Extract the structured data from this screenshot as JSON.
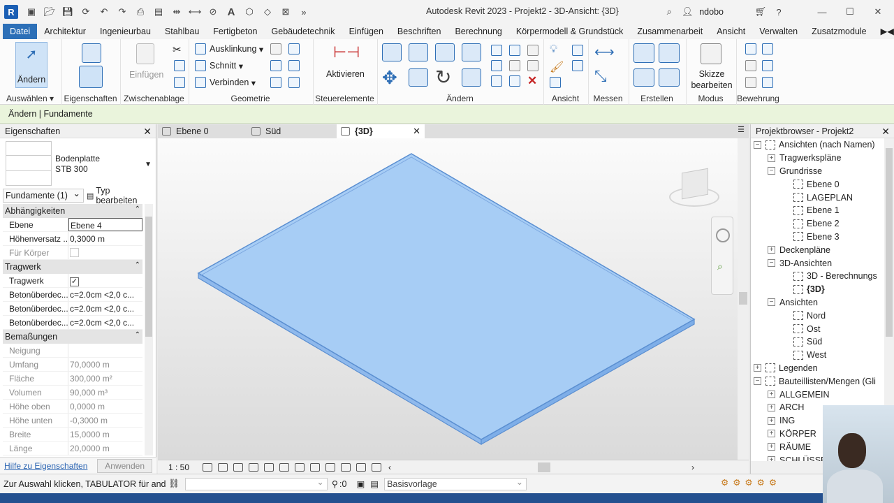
{
  "titlebar": {
    "app_icon_letter": "R",
    "title": "Autodesk Revit 2023 - Projekt2 - 3D-Ansicht: {3D}",
    "user": "ndobo"
  },
  "ribbon_tabs": [
    "Datei",
    "Architektur",
    "Ingenieurbau",
    "Stahlbau",
    "Fertigbeton",
    "Gebäudetechnik",
    "Einfügen",
    "Beschriften",
    "Berechnung",
    "Körpermodell & Grundstück",
    "Zusammenarbeit",
    "Ansicht",
    "Verwalten",
    "Zusatzmodule"
  ],
  "ribbon": {
    "modify_label": "Ändern",
    "paste_label": "Einfügen",
    "cope_label": "Ausklinkung",
    "cut_label": "Schnitt",
    "join_label": "Verbinden",
    "activate_label": "Aktivieren",
    "sketch_label": "Skizze bearbeiten",
    "groups": {
      "select": "Auswählen",
      "properties": "Eigenschaften",
      "clipboard": "Zwischenablage",
      "geometry": "Geometrie",
      "controls": "Steuerelemente",
      "modify": "Ändern",
      "view": "Ansicht",
      "measure": "Messen",
      "create": "Erstellen",
      "mode": "Modus",
      "reinforcement": "Bewehrung"
    }
  },
  "context": "Ändern | Fundamente",
  "properties": {
    "title": "Eigenschaften",
    "family": "Bodenplatte",
    "type": "STB 300",
    "selector": "Fundamente (1)",
    "edit_type": "Typ bearbeiten",
    "categories": [
      {
        "name": "Abhängigkeiten",
        "rows": [
          {
            "name": "Ebene",
            "value": "Ebene 4",
            "style": "boxed"
          },
          {
            "name": "Höhenversatz ...",
            "value": "0,3000 m",
            "style": "normal"
          },
          {
            "name": "Für Körper",
            "value": "",
            "style": "check-grey"
          }
        ]
      },
      {
        "name": "Tragwerk",
        "rows": [
          {
            "name": "Tragwerk",
            "value": "✓",
            "style": "check"
          },
          {
            "name": "Betonüberdec...",
            "value": "c=2.0cm <2,0 c...",
            "style": "normal"
          },
          {
            "name": "Betonüberdec...",
            "value": "c=2.0cm <2,0 c...",
            "style": "normal"
          },
          {
            "name": "Betonüberdec...",
            "value": "c=2.0cm <2,0 c...",
            "style": "normal"
          }
        ]
      },
      {
        "name": "Bemaßungen",
        "rows": [
          {
            "name": "Neigung",
            "value": "",
            "style": "dim"
          },
          {
            "name": "Umfang",
            "value": "70,0000 m",
            "style": "dim"
          },
          {
            "name": "Fläche",
            "value": "300,000 m²",
            "style": "dim"
          },
          {
            "name": "Volumen",
            "value": "90,000 m³",
            "style": "dim"
          },
          {
            "name": "Höhe oben",
            "value": "0,0000 m",
            "style": "dim"
          },
          {
            "name": "Höhe unten",
            "value": "-0,3000 m",
            "style": "dim"
          },
          {
            "name": "Breite",
            "value": "15,0000 m",
            "style": "dim"
          },
          {
            "name": "Länge",
            "value": "20,0000 m",
            "style": "dim"
          }
        ]
      }
    ],
    "help": "Hilfe zu Eigenschaften",
    "apply": "Anwenden"
  },
  "view_tabs": [
    {
      "label": "Ebene 0",
      "active": false
    },
    {
      "label": "Süd",
      "active": false
    },
    {
      "label": "{3D}",
      "active": true
    }
  ],
  "viewport": {
    "scale": "1 : 50",
    "slab_color": "#a7cdf5",
    "slab_edge_color": "#6d9edb"
  },
  "browser": {
    "title": "Projektbrowser - Projekt2",
    "items": [
      {
        "label": "Ansichten (nach Namen)",
        "level": 0,
        "exp": "−",
        "icon": true
      },
      {
        "label": "Tragwerkspläne",
        "level": 1,
        "exp": "+"
      },
      {
        "label": "Grundrisse",
        "level": 1,
        "exp": "−"
      },
      {
        "label": "Ebene 0",
        "level": 2,
        "icon": true
      },
      {
        "label": "LAGEPLAN",
        "level": 2,
        "icon": true
      },
      {
        "label": "Ebene 1",
        "level": 2,
        "icon": true
      },
      {
        "label": "Ebene 2",
        "level": 2,
        "icon": true
      },
      {
        "label": "Ebene 3",
        "level": 2,
        "icon": true
      },
      {
        "label": "Deckenpläne",
        "level": 1,
        "exp": "+"
      },
      {
        "label": "3D-Ansichten",
        "level": 1,
        "exp": "−"
      },
      {
        "label": "3D - Berechnungs",
        "level": 2,
        "icon": true
      },
      {
        "label": "{3D}",
        "level": 2,
        "icon": true,
        "bold": true
      },
      {
        "label": "Ansichten",
        "level": 1,
        "exp": "−"
      },
      {
        "label": "Nord",
        "level": 2,
        "icon": true
      },
      {
        "label": "Ost",
        "level": 2,
        "icon": true
      },
      {
        "label": "Süd",
        "level": 2,
        "icon": true
      },
      {
        "label": "West",
        "level": 2,
        "icon": true
      },
      {
        "label": "Legenden",
        "level": 0,
        "exp": "+",
        "icon": true
      },
      {
        "label": "Bauteillisten/Mengen (Gli",
        "level": 0,
        "exp": "−",
        "icon": true
      },
      {
        "label": "ALLGEMEIN",
        "level": 1,
        "exp": "+"
      },
      {
        "label": "ARCH",
        "level": 1,
        "exp": "+"
      },
      {
        "label": "ING",
        "level": 1,
        "exp": "+"
      },
      {
        "label": "KÖRPER",
        "level": 1,
        "exp": "+"
      },
      {
        "label": "RÄUME",
        "level": 1,
        "exp": "+"
      },
      {
        "label": "SCHLÜSSE",
        "level": 1,
        "exp": "+"
      }
    ]
  },
  "statusbar": {
    "message": "Zur Auswahl klicken, TABULATOR für andere",
    "workset_count": ":0",
    "design_option": "Basisvorlage"
  }
}
